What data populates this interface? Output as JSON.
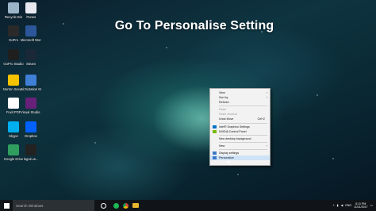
{
  "headline": "Go To Personalise Setting",
  "desktop_icons": [
    {
      "label": "Recycle Bin",
      "icon": "recycle-bin-icon",
      "color": "#9bb4c8"
    },
    {
      "label": "iTunes",
      "icon": "itunes-icon",
      "color": "#e8e8f0"
    },
    {
      "label": "GoPro",
      "icon": "gopro-icon",
      "color": "#2a2a2a"
    },
    {
      "label": "Microsoft Word 2010",
      "icon": "word-icon",
      "color": "#2b579a"
    },
    {
      "label": "GoPro Studio",
      "icon": "gopro-studio-icon",
      "color": "#1f1f1f"
    },
    {
      "label": "Steam",
      "icon": "steam-icon",
      "color": "#1b2838"
    },
    {
      "label": "Norton Security wit...",
      "icon": "norton-icon",
      "color": "#f5c400"
    },
    {
      "label": "Ai Dictation Monitor",
      "icon": "dictation-icon",
      "color": "#3f7fd6"
    },
    {
      "label": "Foxit PDF",
      "icon": "foxit-icon",
      "color": "#ffffff"
    },
    {
      "label": "Visual Studio 2015",
      "icon": "visual-studio-icon",
      "color": "#68217a"
    },
    {
      "label": "Skype",
      "icon": "skype-icon",
      "color": "#00aff0"
    },
    {
      "label": "Dropbox",
      "icon": "dropbox-icon",
      "color": "#0061fe"
    },
    {
      "label": "Google Drive",
      "icon": "google-drive-icon",
      "color": "#2f9e5e"
    },
    {
      "label": "logoin.w...",
      "icon": "logoin-icon",
      "color": "#222222"
    }
  ],
  "context_menu": {
    "items": [
      {
        "label": "View",
        "arrow": true,
        "disabled": false
      },
      {
        "label": "Sort by",
        "arrow": true,
        "disabled": false
      },
      {
        "label": "Refresh",
        "disabled": false
      },
      {
        "sep": true
      },
      {
        "label": "Paste",
        "disabled": true
      },
      {
        "label": "Paste shortcut",
        "disabled": true
      },
      {
        "label": "Undo Move",
        "shortcut": "Ctrl+Z",
        "disabled": false
      },
      {
        "sep": true
      },
      {
        "label": "Intel® Graphics Settings",
        "icon": "intel-graphics-icon",
        "disabled": false
      },
      {
        "label": "NVIDIA Control Panel",
        "icon": "nvidia-icon",
        "disabled": false
      },
      {
        "sep": true
      },
      {
        "label": "New desktop background",
        "disabled": false
      },
      {
        "sep": true
      },
      {
        "label": "New",
        "arrow": true,
        "disabled": false
      },
      {
        "sep": true
      },
      {
        "label": "Display settings",
        "icon": "display-settings-icon",
        "disabled": false
      },
      {
        "label": "Personalize",
        "icon": "personalize-icon",
        "disabled": false,
        "hover": true
      }
    ]
  },
  "taskbar": {
    "search_placeholder": "Search Windows",
    "apps": [
      "task-view-icon",
      "spotify-icon",
      "chrome-icon",
      "folder-icon",
      "store-icon"
    ],
    "time": "6:11 PM",
    "date": "11/11/2017",
    "language": "ENG"
  },
  "colors": {
    "accent_hover": "#cfe3f7",
    "taskbar": "#101418"
  }
}
